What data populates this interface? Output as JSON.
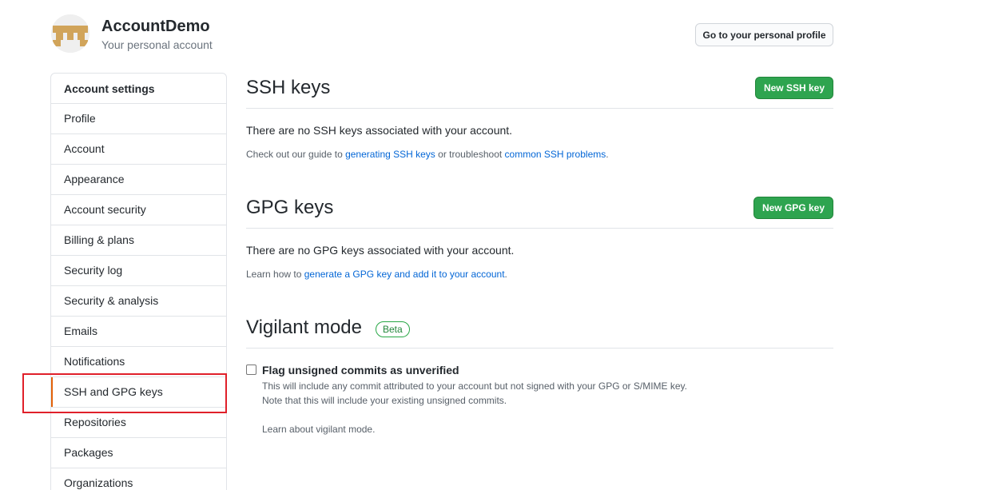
{
  "header": {
    "account_name": "AccountDemo",
    "account_subtitle": "Your personal account",
    "profile_button": "Go to your personal profile"
  },
  "sidebar": {
    "heading": "Account settings",
    "selected": "SSH and GPG keys",
    "items": [
      {
        "label": "Profile"
      },
      {
        "label": "Account"
      },
      {
        "label": "Appearance"
      },
      {
        "label": "Account security"
      },
      {
        "label": "Billing & plans"
      },
      {
        "label": "Security log"
      },
      {
        "label": "Security & analysis"
      },
      {
        "label": "Emails"
      },
      {
        "label": "Notifications"
      },
      {
        "label": "SSH and GPG keys"
      },
      {
        "label": "Repositories"
      },
      {
        "label": "Packages"
      },
      {
        "label": "Organizations"
      }
    ]
  },
  "ssh": {
    "title": "SSH keys",
    "button": "New SSH key",
    "empty": "There are no SSH keys associated with your account.",
    "guide_prefix": "Check out our guide to ",
    "guide_link": "generating SSH keys",
    "guide_middle": " or troubleshoot ",
    "guide_link2": "common SSH problems",
    "guide_suffix": "."
  },
  "gpg": {
    "title": "GPG keys",
    "button": "New GPG key",
    "empty": "There are no GPG keys associated with your account.",
    "learn_prefix": "Learn how to ",
    "learn_link": "generate a GPG key and add it to your account",
    "learn_suffix": "."
  },
  "vigilant": {
    "title": "Vigilant mode",
    "badge": "Beta",
    "checkbox_label": "Flag unsigned commits as unverified",
    "checked": false,
    "note_line1": "This will include any commit attributed to your account but not signed with your GPG or S/MIME key.",
    "note_line2": "Note that this will include your existing unsigned commits.",
    "learn_link": "Learn about vigilant mode."
  },
  "colors": {
    "primary_green": "#2ea44f",
    "link_blue": "#0366d6",
    "selected_marker": "#e36209",
    "annotation_red": "#e0202a"
  }
}
